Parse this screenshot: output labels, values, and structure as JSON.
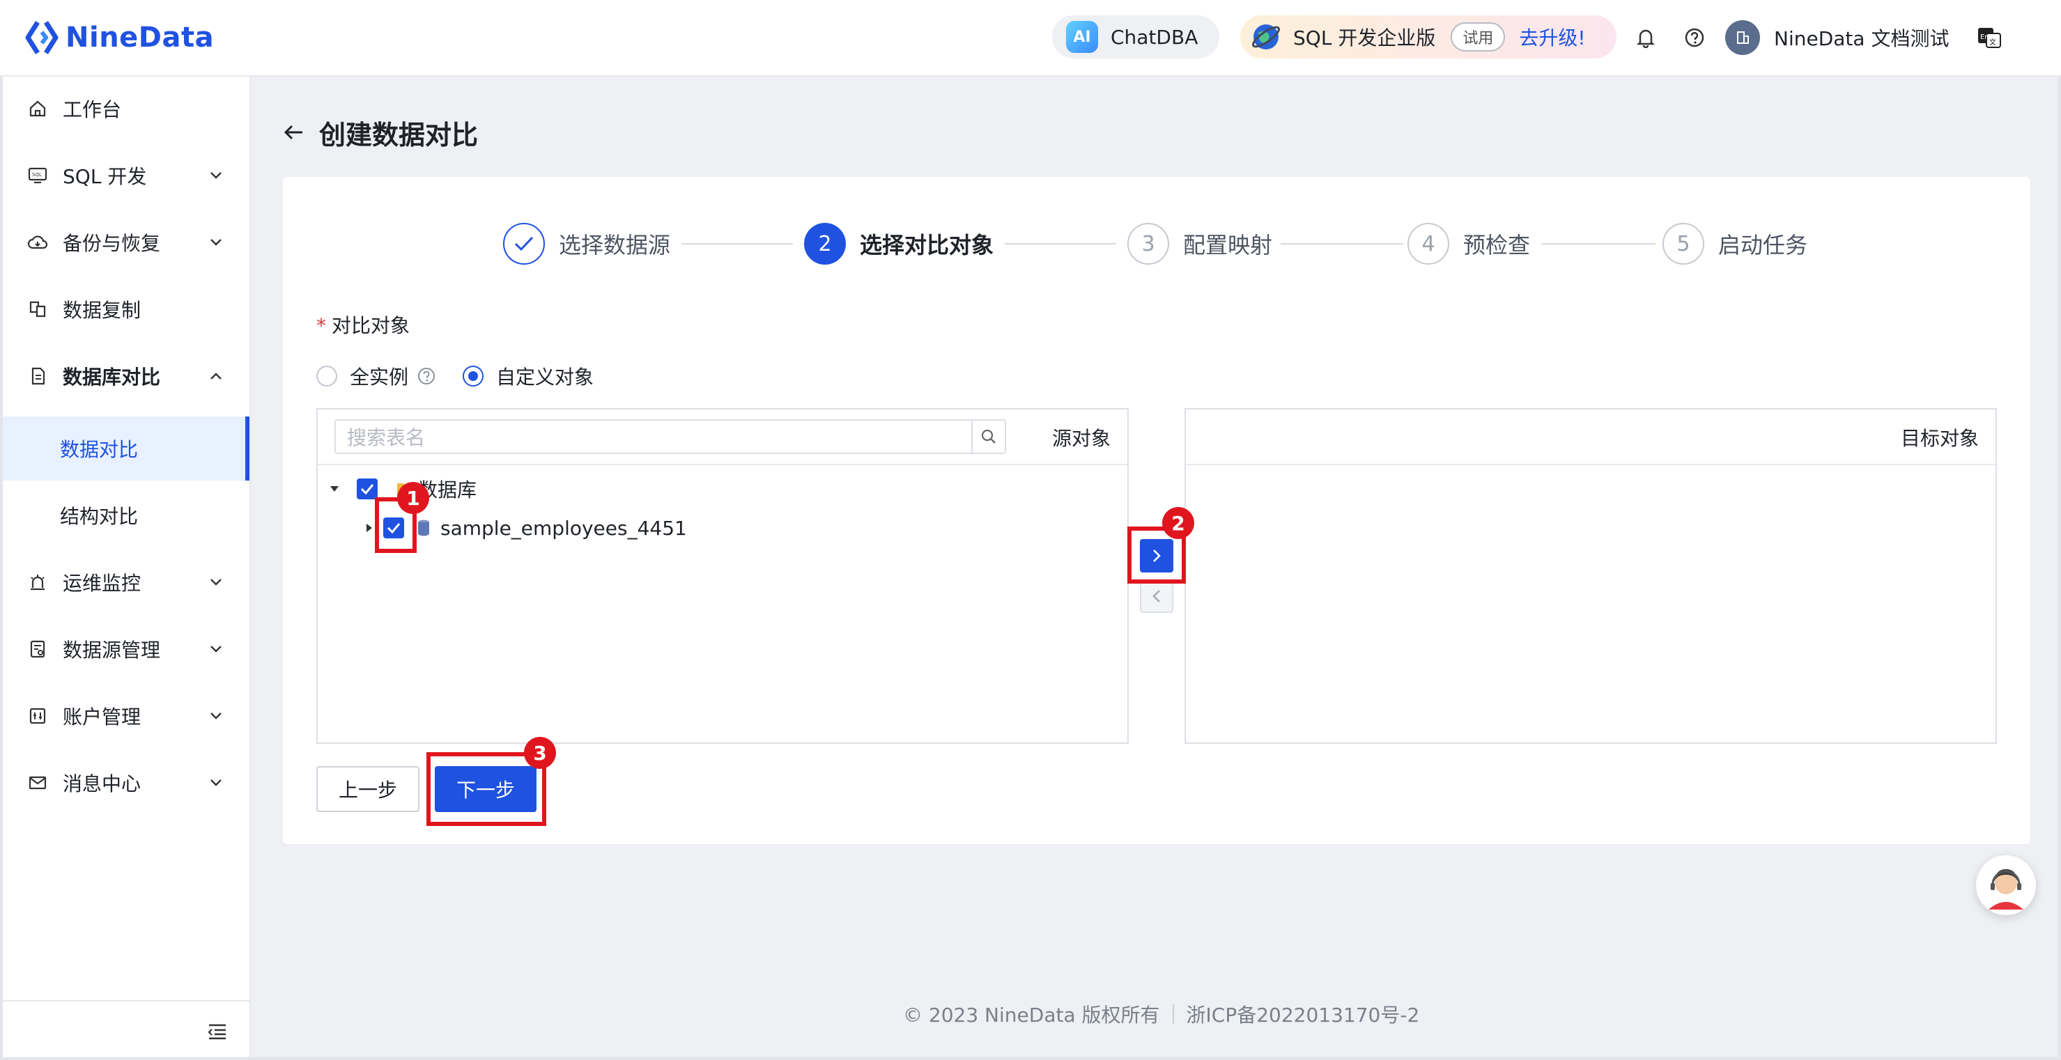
{
  "header": {
    "brand": "NineData",
    "chat_label": "ChatDBA",
    "chat_badge": "AI",
    "edition_label": "SQL 开发企业版",
    "trial_label": "试用",
    "upgrade_label": "去升级!",
    "user_name": "NineData 文档测试"
  },
  "sidebar": {
    "items": [
      {
        "label": "工作台"
      },
      {
        "label": "SQL 开发"
      },
      {
        "label": "备份与恢复"
      },
      {
        "label": "数据复制"
      },
      {
        "label": "数据库对比"
      },
      {
        "label": "数据对比"
      },
      {
        "label": "结构对比"
      },
      {
        "label": "运维监控"
      },
      {
        "label": "数据源管理"
      },
      {
        "label": "账户管理"
      },
      {
        "label": "消息中心"
      }
    ]
  },
  "page": {
    "title": "创建数据对比"
  },
  "steps": [
    {
      "num": "",
      "label": "选择数据源",
      "state": "done"
    },
    {
      "num": "2",
      "label": "选择对比对象",
      "state": "current"
    },
    {
      "num": "3",
      "label": "配置映射",
      "state": "todo"
    },
    {
      "num": "4",
      "label": "预检查",
      "state": "todo"
    },
    {
      "num": "5",
      "label": "启动任务",
      "state": "todo"
    }
  ],
  "form": {
    "required_mark": "*",
    "object_label": "对比对象",
    "radio_all": "全实例",
    "radio_custom": "自定义对象",
    "selected": "自定义对象"
  },
  "source": {
    "search_placeholder": "搜索表名",
    "title": "源对象",
    "root_label": "数据库",
    "db_label": "sample_employees_4451"
  },
  "target": {
    "title": "目标对象"
  },
  "buttons": {
    "prev": "上一步",
    "next": "下一步"
  },
  "annotations": {
    "a1": "1",
    "a2": "2",
    "a3": "3"
  },
  "footer": {
    "copyright": "© 2023 NineData 版权所有",
    "icp": "浙ICP备2022013170号-2"
  },
  "colors": {
    "primary": "#1f52e0",
    "highlight": "#e0161f"
  }
}
